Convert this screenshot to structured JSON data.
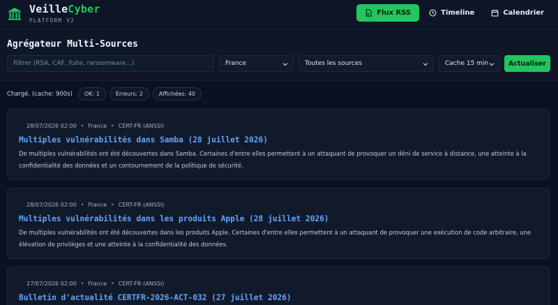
{
  "brand": {
    "name_part1": "Veille",
    "name_part2": "Cyber",
    "subtitle": "PLATFORM V2",
    "logo_icon": "bank-icon"
  },
  "nav": {
    "items": [
      {
        "label": "Flux RSS",
        "icon": "rss-file-icon",
        "active": true
      },
      {
        "label": "Timeline",
        "icon": "clock-icon",
        "active": false
      },
      {
        "label": "Calendrier",
        "icon": "calendar-icon",
        "active": false
      }
    ]
  },
  "aggregator": {
    "title": "Agrégateur Multi-Sources",
    "filter_placeholder": "Filtrer (RSA, CAF, fuite, ransomware...)",
    "filter_value": "",
    "country_selected": "France",
    "source_selected": "Toutes les sources",
    "cache_selected": "Cache 15 min",
    "refresh_label": "Actualiser"
  },
  "status": {
    "text": "Chargé. (cache: 900s)",
    "ok": "OK: 1",
    "errors": "Erreurs: 2",
    "displayed": "Affichées: 40"
  },
  "articles": [
    {
      "date": "28/07/2026 02:00",
      "country": "France",
      "source": "CERT-FR (ANSSI)",
      "title": "Multiples vulnérabilités dans Samba (28 juillet 2026)",
      "description": "De multiples vulnérabilités ont été découvertes dans Samba. Certaines d'entre elles permettent à un attaquant de provoquer un déni de service à distance, une atteinte à la confidentialité des données et un contournement de la politique de sécurité."
    },
    {
      "date": "28/07/2026 02:00",
      "country": "France",
      "source": "CERT-FR (ANSSI)",
      "title": "Multiples vulnérabilités dans les produits Apple (28 juillet 2026)",
      "description": "De multiples vulnérabilités ont été découvertes dans les produits Apple. Certaines d'entre elles permettent à un attaquant de provoquer une exécution de code arbitraire, une élévation de privilèges et une atteinte à la confidentialité des données."
    },
    {
      "date": "27/07/2026 02:00",
      "country": "France",
      "source": "CERT-FR (ANSSI)",
      "title": "Bulletin d'actualité CERTFR-2026-ACT-032 (27 juillet 2026)",
      "description": ""
    }
  ],
  "colors": {
    "accent": "#22c55e",
    "link": "#60a5fa",
    "background": "#0b1120",
    "card": "#111a2b"
  }
}
